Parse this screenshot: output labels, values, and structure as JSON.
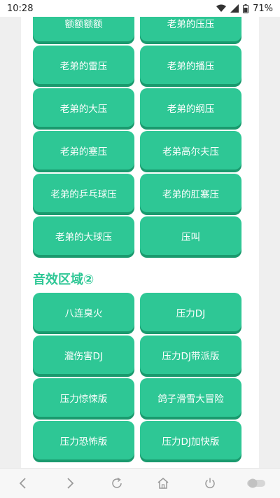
{
  "status": {
    "time": "10:28",
    "battery": "71%"
  },
  "top_buttons": [
    "额额额额",
    "老弟的压压",
    "老弟的雷压",
    "老弟的播压",
    "老弟的大压",
    "老弟的纲压",
    "老弟的塞压",
    "老弟高尔夫压",
    "老弟的乒乓球压",
    "老弟的肛塞压",
    "老弟的大球压",
    "压叫"
  ],
  "section2": {
    "title": "音效区域②",
    "buttons": [
      "八连臭火",
      "压力DJ",
      "瀧伤害DJ",
      "压力DJ带派版",
      "压力惊悚版",
      "鸽子滑雪大冒险",
      "压力恐怖版",
      "压力DJ加快版"
    ]
  },
  "nav": {
    "icons": [
      "back-icon",
      "forward-icon",
      "refresh-icon",
      "home-icon",
      "power-icon",
      "toggle-icon"
    ]
  },
  "colors": {
    "accent": "#2ec795",
    "accent_shadow": "#1a9a6e"
  }
}
